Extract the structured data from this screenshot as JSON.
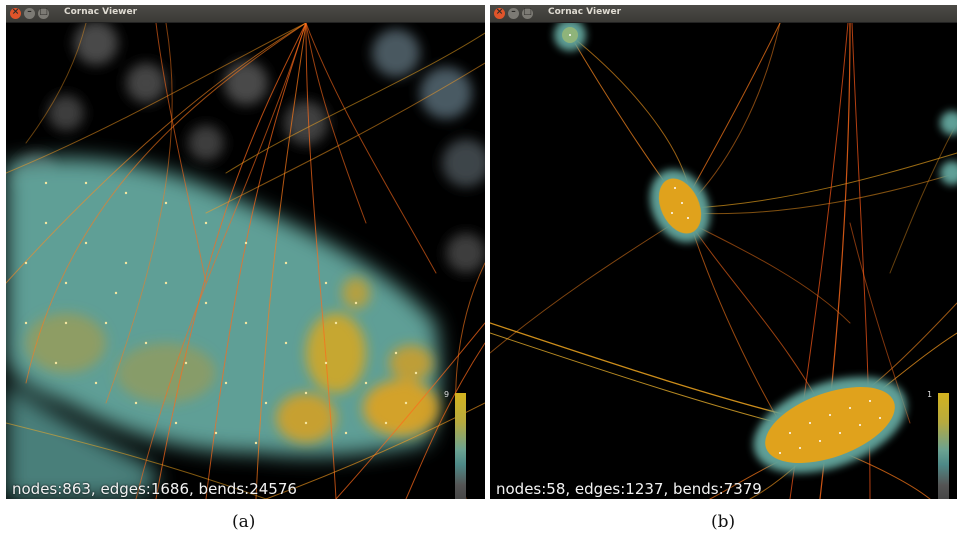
{
  "windows": [
    {
      "id": "a",
      "title": "Cornac Viewer",
      "stats": "nodes:863, edges:1686, bends:24576",
      "legend": {
        "max": "9",
        "min": "0"
      },
      "caption": "(a)"
    },
    {
      "id": "b",
      "title": "Cornac Viewer",
      "stats": "nodes:58, edges:1237, bends:7379",
      "legend": {
        "max": "1",
        "min": "0"
      },
      "caption": "(b)"
    }
  ],
  "colors": {
    "background": "#000000",
    "edge_orange": "#ff6a1a",
    "edge_yellow": "#ffae1f",
    "node_teal": "#5f9f96",
    "node_gold": "#e0a21c",
    "close_button": "#e0542a"
  },
  "icons": {
    "close": "close-icon",
    "minimize": "minimize-icon",
    "maximize": "maximize-icon"
  }
}
